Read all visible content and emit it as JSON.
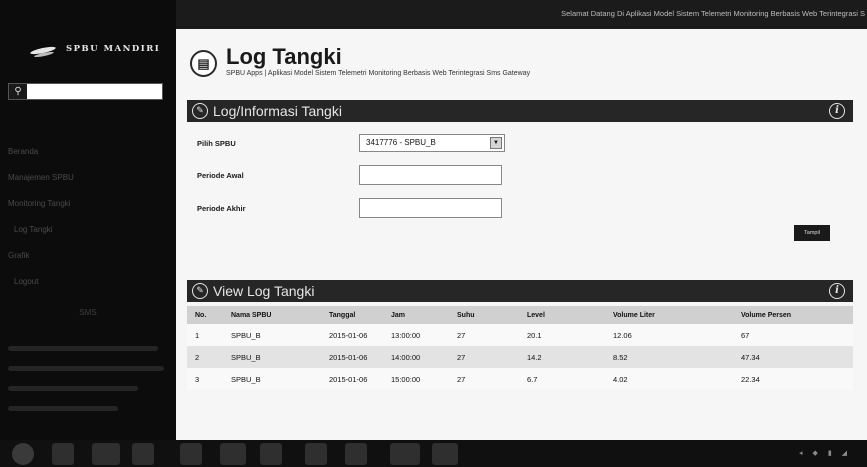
{
  "sidebar": {
    "brand": "SPBU MANDIRI",
    "search_button": "⚲",
    "search_placeholder": "",
    "nav": [
      "Beranda",
      "Manajemen SPBU",
      "Monitoring Tangki",
      "Log Tangki",
      "Grafik",
      "Logout"
    ],
    "footer": "SMS"
  },
  "topbar": {
    "welcome": "Selamat Datang Di Aplikasi Model Sistem Telemetri Monitoring Berbasis Web Terintegrasi S"
  },
  "header": {
    "icon": "log-book-icon",
    "title": "Log Tangki",
    "subtitle": "SPBU Apps | Aplikasi Model Sistem Telemetri Monitoring Berbasis Web Terintegrasi Sms Gateway"
  },
  "log_panel": {
    "title": "Log/Informasi Tangki",
    "pilih_spbu_label": "Pilih SPBU",
    "pilih_spbu_value": "3417776 - SPBU_B",
    "periode_awal_label": "Periode Awal",
    "periode_awal_value": "",
    "periode_akhir_label": "Periode Akhir",
    "periode_akhir_value": "",
    "tampil_button": "Tampil"
  },
  "view_panel": {
    "title": "View Log Tangki",
    "columns": [
      "No.",
      "Nama SPBU",
      "Tanggal",
      "Jam",
      "Suhu",
      "Level",
      "Volume Liter",
      "Volume Persen"
    ],
    "rows": [
      [
        "1",
        "SPBU_B",
        "2015-01-06",
        "13:00:00",
        "27",
        "20.1",
        "12.06",
        "67"
      ],
      [
        "2",
        "SPBU_B",
        "2015-01-06",
        "14:00:00",
        "27",
        "14.2",
        "8.52",
        "47.34"
      ],
      [
        "3",
        "SPBU_B",
        "2015-01-06",
        "15:00:00",
        "27",
        "6.7",
        "4.02",
        "22.34"
      ]
    ]
  },
  "colors": {
    "sidebar_bg": "#0c0c0c",
    "panel_header_bg": "#262626",
    "table_header_bg": "#d0d0d0",
    "row_alt_bg": "#e3e3e3"
  }
}
